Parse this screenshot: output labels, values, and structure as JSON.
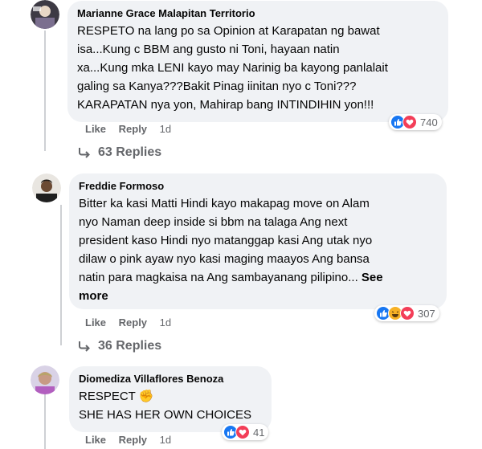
{
  "comments": [
    {
      "author": "Marianne Grace Malapitan Territorio",
      "text": "RESPETO na lang po sa Opinion at Karapatan ng bawat\nisa...Kung c BBM ang gusto ni Toni, hayaan natin\nxa...Kung mka LENI kayo may Narinig ba kayong panlalait\ngaling sa Kanya???Bakit Pinag iinitan nyo c Toni???\nKARAPATAN nya yon, Mahirap bang INTINDIHIN yon!!!",
      "like_label": "Like",
      "reply_label": "Reply",
      "time": "1d",
      "reaction_count": "740",
      "reactions": [
        "like-icon",
        "love-icon"
      ],
      "replies_label": "63 Replies"
    },
    {
      "author": "Freddie Formoso",
      "text": "Bitter ka kasi Matti Hindi kayo makapag move on Alam\nnyo Naman deep inside si bbm na talaga Ang next\npresident kaso Hindi nyo matanggap kasi Ang utak nyo\ndilaw o pink ayaw nyo kasi maging maayos Ang bansa\nnatin para magkaisa na Ang sambayanang pilipino...",
      "see_more": "See\nmore",
      "like_label": "Like",
      "reply_label": "Reply",
      "time": "1d",
      "reaction_count": "307",
      "reactions": [
        "like-icon",
        "haha-icon",
        "love-icon"
      ],
      "replies_label": "36 Replies"
    },
    {
      "author": "Diomediza Villaflores Benoza",
      "text": "RESPECT ✊\nSHE HAS HER OWN CHOICES",
      "like_label": "Like",
      "reply_label": "Reply",
      "time": "1d",
      "reaction_count": "41",
      "reactions": [
        "like-icon",
        "love-icon"
      ]
    }
  ],
  "colors": {
    "bubble": "#f0f2f5",
    "meta_text": "#65676b",
    "like_blue": "#1877f2",
    "love_red": "#f33e58",
    "haha_yellow": "#f7b125"
  }
}
